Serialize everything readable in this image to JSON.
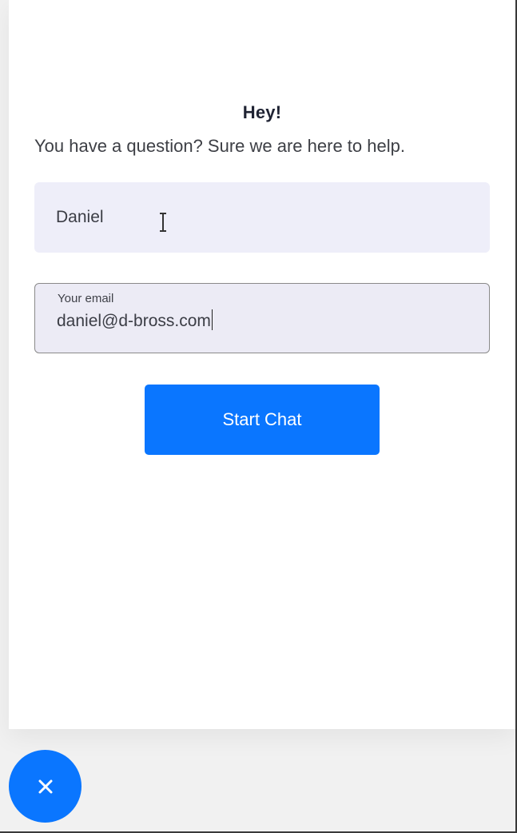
{
  "chat": {
    "greeting": "Hey!",
    "subtitle": "You have a question? Sure we are here to help."
  },
  "form": {
    "name_value": "Daniel",
    "email_label": "Your email",
    "email_value": "daniel@d-bross.com",
    "start_button_label": "Start Chat"
  },
  "launcher": {
    "icon": "close-icon"
  },
  "colors": {
    "accent": "#0A76FF",
    "field_background": "#EEEEF9",
    "text_primary": "#1F2333",
    "text_secondary": "#3D3F45"
  },
  "icons": {
    "text_cursor": "i-beam-cursor-icon",
    "launcher_close": "close-icon"
  }
}
